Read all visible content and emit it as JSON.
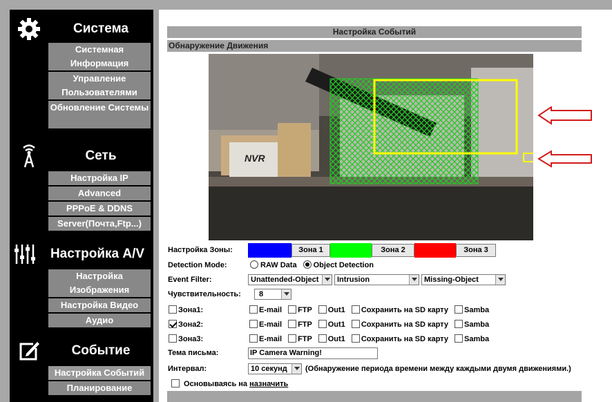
{
  "sidebar": {
    "system": {
      "title": "Система",
      "items": [
        "Системная Информация",
        "Управление Пользователями",
        "Обновление Системы"
      ]
    },
    "network": {
      "title": "Сеть",
      "items": [
        "Настройка IP",
        "Advanced",
        "PPPoE & DDNS",
        "Server(Почта,Ftp...)"
      ]
    },
    "av": {
      "title": "Настройка A/V",
      "items": [
        "Настройка Изображения",
        "Настройка Видео",
        "Аудио"
      ]
    },
    "event": {
      "title": "Событие",
      "items": [
        "Настройка Событий",
        "Планирование"
      ]
    }
  },
  "page": {
    "title": "Настройка Событий",
    "section": "Обнаружение Движения"
  },
  "preview": {
    "camera_text": "NVR"
  },
  "form": {
    "zone_setting_label": "Настройка Зоны:",
    "zones": [
      {
        "label": "Зона 1",
        "color": "#0000ff"
      },
      {
        "label": "Зона 2",
        "color": "#00ff00"
      },
      {
        "label": "Зона 3",
        "color": "#ff0000"
      }
    ],
    "detection_mode_label": "Detection Mode:",
    "detection_modes": [
      {
        "label": "RAW Data",
        "selected": false
      },
      {
        "label": "Object Detection",
        "selected": true
      }
    ],
    "event_filter_label": "Event Filter:",
    "event_filters": [
      "Unattended-Object",
      "Intrusion",
      "Missing-Object"
    ],
    "sensitivity_label": "Чувствительность:",
    "sensitivity_value": "8",
    "zone_rows": [
      {
        "label": "Зона1:",
        "checked": false
      },
      {
        "label": "Зона2:",
        "checked": true
      },
      {
        "label": "Зона3:",
        "checked": false
      }
    ],
    "actions": [
      "E-mail",
      "FTP",
      "Out1",
      "Сохранить на SD карту",
      "Samba"
    ],
    "subject_label": "Тема письма:",
    "subject_value": "IP Camera Warning!",
    "interval_label": "Интервал:",
    "interval_value": "10 секунд",
    "interval_note": "(Обнаружение периода времени между каждыми двумя движениями.)",
    "schedule_prefix": "Основываясь на",
    "schedule_link": "назначить"
  }
}
